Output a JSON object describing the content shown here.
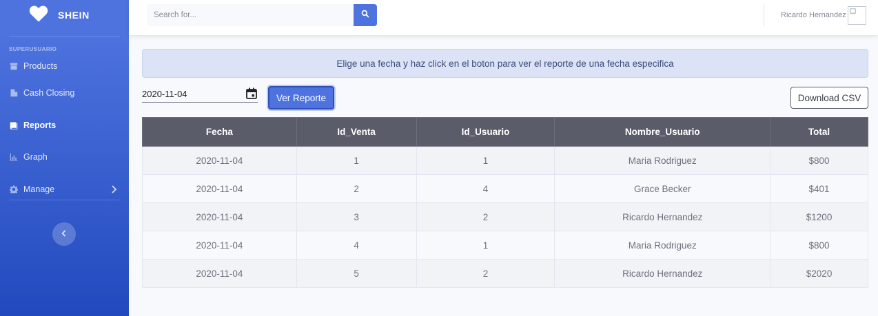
{
  "sidebar": {
    "brand": "SHEIN",
    "heading": "SUPERUSUARIO",
    "items": [
      {
        "label": "Products",
        "icon": "box-icon"
      },
      {
        "label": "Cash Closing",
        "icon": "building-icon"
      },
      {
        "label": "Reports",
        "icon": "book-icon",
        "active": true
      },
      {
        "label": "Graph",
        "icon": "chart-icon"
      },
      {
        "label": "Manage",
        "icon": "gear-icon",
        "has_submenu": true
      }
    ]
  },
  "topbar": {
    "search_placeholder": "Search for...",
    "user_name": "Ricardo Hernandez"
  },
  "main": {
    "alert": "Elige una fecha y haz click en el boton para ver el reporte de una fecha especifica",
    "date_value": "2020-11-04",
    "ver_reporte_label": "Ver Reporte",
    "download_csv_label": "Download CSV",
    "table": {
      "headers": [
        "Fecha",
        "Id_Venta",
        "Id_Usuario",
        "Nombre_Usuario",
        "Total"
      ],
      "rows": [
        [
          "2020-11-04",
          "1",
          "1",
          "Maria Rodriguez",
          "$800"
        ],
        [
          "2020-11-04",
          "2",
          "4",
          "Grace Becker",
          "$401"
        ],
        [
          "2020-11-04",
          "3",
          "2",
          "Ricardo Hernandez",
          "$1200"
        ],
        [
          "2020-11-04",
          "4",
          "1",
          "Maria Rodriguez",
          "$800"
        ],
        [
          "2020-11-04",
          "5",
          "2",
          "Ricardo Hernandez",
          "$2020"
        ]
      ]
    }
  },
  "colors": {
    "primary": "#4e73df",
    "primary_dark": "#224abe",
    "table_header": "#5a5c69",
    "alert_bg": "#dde3f6"
  }
}
